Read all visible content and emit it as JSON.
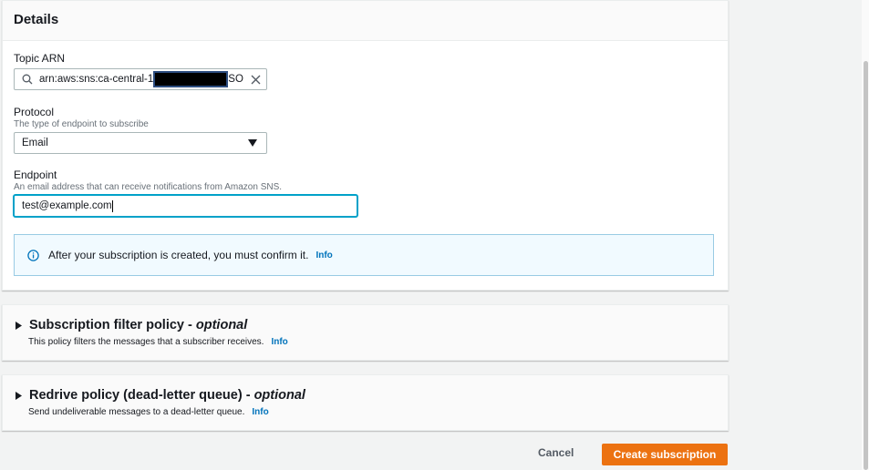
{
  "details": {
    "title": "Details",
    "topic_arn": {
      "label": "Topic ARN",
      "value_prefix": "arn:aws:sns:ca-central-1",
      "value_suffix": "SO"
    },
    "protocol": {
      "label": "Protocol",
      "description": "The type of endpoint to subscribe",
      "value": "Email"
    },
    "endpoint": {
      "label": "Endpoint",
      "description": "An email address that can receive notifications from Amazon SNS.",
      "value": "test@example.com"
    },
    "info_alert": {
      "text": "After your subscription is created, you must confirm it.",
      "link": "Info"
    }
  },
  "filter_policy": {
    "title": "Subscription filter policy - ",
    "optional": "optional",
    "description": "This policy filters the messages that a subscriber receives.",
    "link": "Info"
  },
  "redrive_policy": {
    "title": "Redrive policy (dead-letter queue) - ",
    "optional": "optional",
    "description": "Send undeliverable messages to a dead-letter queue.",
    "link": "Info"
  },
  "actions": {
    "cancel": "Cancel",
    "create": "Create subscription"
  }
}
